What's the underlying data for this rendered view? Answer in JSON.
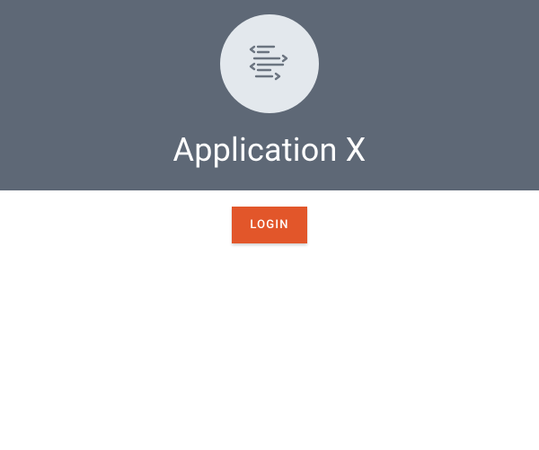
{
  "app": {
    "title": "Application X",
    "icon": "code-flow-icon"
  },
  "actions": {
    "login_label": "LOGIN"
  },
  "colors": {
    "hero_bg": "#5e6876",
    "logo_bg": "#e3e8ed",
    "accent": "#e2562a",
    "icon_stroke": "#6b7480"
  }
}
